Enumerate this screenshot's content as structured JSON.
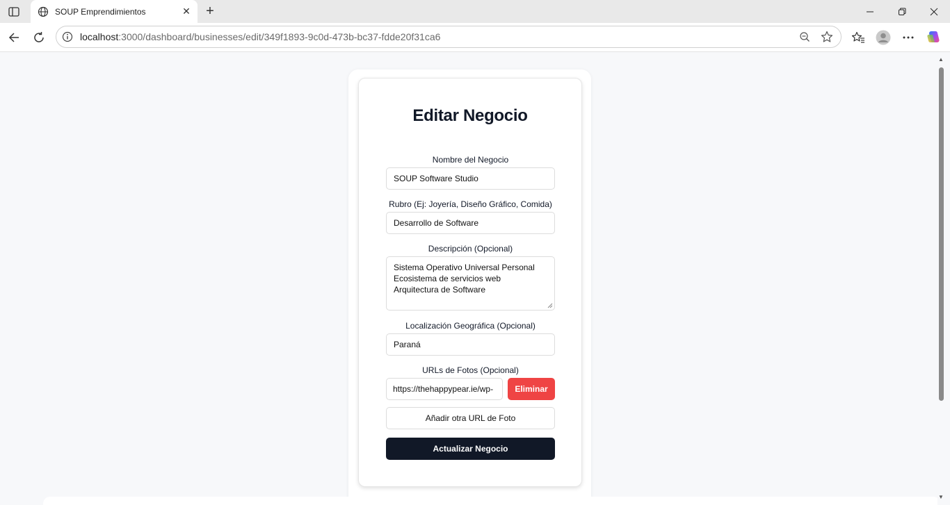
{
  "browser": {
    "tab_title": "SOUP Emprendimientos",
    "url_host": "localhost",
    "url_rest": ":3000/dashboard/businesses/edit/349f1893-9c0d-473b-bc37-fdde20f31ca6",
    "icons": [
      "sidebar-toggle-icon",
      "globe-icon",
      "close-icon",
      "plus-icon",
      "minimize-icon",
      "restore-icon",
      "back-icon",
      "reload-icon",
      "info-icon",
      "zoom-out-icon",
      "star-icon",
      "favorites-icon",
      "profile-icon",
      "more-icon",
      "copilot-icon"
    ]
  },
  "form": {
    "title": "Editar Negocio",
    "name_label": "Nombre del Negocio",
    "name_value": "SOUP Software Studio",
    "category_label": "Rubro (Ej: Joyería, Diseño Gráfico, Comida)",
    "category_value": "Desarrollo de Software",
    "description_label": "Descripción (Opcional)",
    "description_lines": [
      "Sistema Operativo Universal Personal",
      "Ecosistema de servicios web",
      "Arquitectura de Software"
    ],
    "location_label": "Localización Geográfica (Opcional)",
    "location_value": "Paraná",
    "photos_label": "URLs de Fotos (Opcional)",
    "photo_url_value": "https://thehappypear.ie/wp-",
    "remove_button": "Eliminar",
    "add_photo_button": "Añadir otra URL de Foto",
    "submit_button": "Actualizar Negocio"
  },
  "colors": {
    "primary": "#111827",
    "danger": "#ef4444"
  }
}
